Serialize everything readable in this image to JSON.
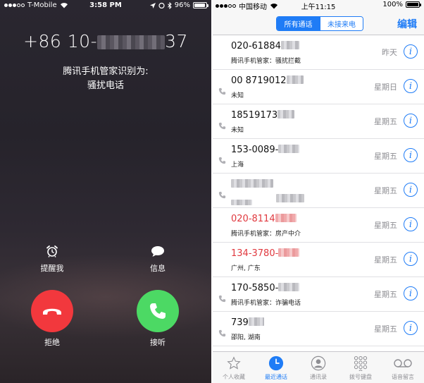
{
  "incoming_call": {
    "status_bar": {
      "carrier": "T-Mobile",
      "time": "3:58 PM",
      "battery": "96%",
      "battery_level": 0.96
    },
    "caller": {
      "number_prefix": "+86 10-",
      "number_suffix": "37",
      "identified_by": "腾讯手机管家识别为:",
      "label": "骚扰电话"
    },
    "actions": {
      "remind_label": "提醒我",
      "message_label": "信息",
      "decline_label": "拒绝",
      "accept_label": "接听"
    },
    "colors": {
      "decline": "#f2383d",
      "accept": "#4cd964"
    }
  },
  "recents": {
    "status_bar": {
      "carrier": "中国移动",
      "time": "上午11:15",
      "battery": "100%",
      "battery_level": 1.0
    },
    "segments": {
      "all": "所有通话",
      "missed": "未接来电"
    },
    "edit_label": "编辑",
    "calls": [
      {
        "number": "020-61884",
        "blur_w": 26,
        "red": false,
        "missed_icon": false,
        "sub": "腾讯手机管家：骚扰拦截",
        "date": "昨天"
      },
      {
        "number": "00 8719012",
        "blur_w": 24,
        "red": false,
        "missed_icon": true,
        "sub": "未知",
        "date": "星期日"
      },
      {
        "number": "18519173",
        "blur_w": 24,
        "red": false,
        "missed_icon": true,
        "sub": "未知",
        "date": "星期五"
      },
      {
        "number": "153-0089-",
        "blur_w": 30,
        "red": false,
        "missed_icon": true,
        "sub": "上海",
        "date": "星期五"
      },
      {
        "number": "",
        "blur_w": 60,
        "red": false,
        "missed_icon": true,
        "sub": "",
        "sub_blur": true,
        "date": "星期五"
      },
      {
        "number": "020-8114",
        "blur_w": 30,
        "red": true,
        "missed_icon": false,
        "sub": "腾讯手机管家：房产中介",
        "date": "星期五"
      },
      {
        "number": "134-3780-",
        "blur_w": 30,
        "red": true,
        "missed_icon": false,
        "sub": "广州, 广东",
        "date": "星期五"
      },
      {
        "number": "170-5850-",
        "blur_w": 30,
        "red": false,
        "missed_icon": true,
        "sub": "腾讯手机管家：诈骗电话",
        "date": "星期五"
      },
      {
        "number": "739",
        "blur_w": 22,
        "red": false,
        "missed_icon": true,
        "sub": "邵阳, 湖南",
        "date": "星期五"
      }
    ],
    "tabs": [
      {
        "label": "个人收藏",
        "icon": "star-icon",
        "active": false
      },
      {
        "label": "最近通话",
        "icon": "clock-icon",
        "active": true
      },
      {
        "label": "通讯录",
        "icon": "contacts-icon",
        "active": false
      },
      {
        "label": "拨号键盘",
        "icon": "keypad-icon",
        "active": false
      },
      {
        "label": "语音留言",
        "icon": "voicemail-icon",
        "active": false
      }
    ],
    "colors": {
      "accent": "#1f7cf6",
      "missed": "#e0383e"
    }
  }
}
